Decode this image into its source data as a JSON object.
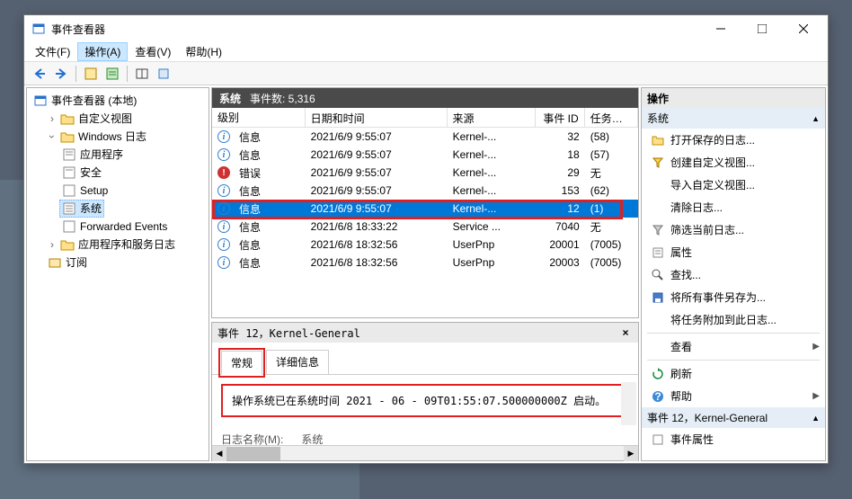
{
  "window": {
    "title": "事件查看器"
  },
  "menu": {
    "file": "文件(F)",
    "action": "操作(A)",
    "view": "查看(V)",
    "help": "帮助(H)"
  },
  "tree": {
    "root": "事件查看器 (本地)",
    "custom": "自定义视图",
    "winlogs": "Windows 日志",
    "app": "应用程序",
    "security": "安全",
    "setup": "Setup",
    "system": "系统",
    "forwarded": "Forwarded Events",
    "appsvc": "应用程序和服务日志",
    "subscribe": "订阅"
  },
  "grid": {
    "title": "系统",
    "count_label": "事件数: 5,316",
    "col_level": "级别",
    "col_datetime": "日期和时间",
    "col_source": "来源",
    "col_eventid": "事件 ID",
    "col_taskcat": "任务类别"
  },
  "level": {
    "info": "信息",
    "error": "错误"
  },
  "rows": [
    {
      "level": "info",
      "dt": "2021/6/9 9:55:07",
      "src": "Kernel-...",
      "id": "32",
      "cat": "(58)"
    },
    {
      "level": "info",
      "dt": "2021/6/9 9:55:07",
      "src": "Kernel-...",
      "id": "18",
      "cat": "(57)"
    },
    {
      "level": "error",
      "dt": "2021/6/9 9:55:07",
      "src": "Kernel-...",
      "id": "29",
      "cat": "无"
    },
    {
      "level": "info",
      "dt": "2021/6/9 9:55:07",
      "src": "Kernel-...",
      "id": "153",
      "cat": "(62)"
    },
    {
      "level": "info",
      "dt": "2021/6/9 9:55:07",
      "src": "Kernel-...",
      "id": "12",
      "cat": "(1)",
      "selected": true
    },
    {
      "level": "info",
      "dt": "2021/6/8 18:33:22",
      "src": "Service ...",
      "id": "7040",
      "cat": "无"
    },
    {
      "level": "info",
      "dt": "2021/6/8 18:32:56",
      "src": "UserPnp",
      "id": "20001",
      "cat": "(7005)"
    },
    {
      "level": "info",
      "dt": "2021/6/8 18:32:56",
      "src": "UserPnp",
      "id": "20003",
      "cat": "(7005)"
    }
  ],
  "detail": {
    "title": "事件 12，Kernel-General",
    "tab_general": "常规",
    "tab_detail": "详细信息",
    "message": "操作系统已在系统时间 ‎2021‎ - ‎06‎ - ‎09T01:55:07.500000000Z 启动。",
    "logname_label": "日志名称(M):",
    "logname_value": "系统"
  },
  "actions": {
    "header": "操作",
    "section1": "系统",
    "open_saved": "打开保存的日志...",
    "create_custom": "创建自定义视图...",
    "import_custom": "导入自定义视图...",
    "clear_log": "清除日志...",
    "filter_current": "筛选当前日志...",
    "properties": "属性",
    "find": "查找...",
    "save_all": "将所有事件另存为...",
    "attach_task": "将任务附加到此日志...",
    "view": "查看",
    "refresh": "刷新",
    "help": "帮助",
    "section2": "事件 12，Kernel-General",
    "event_props": "事件属性"
  }
}
